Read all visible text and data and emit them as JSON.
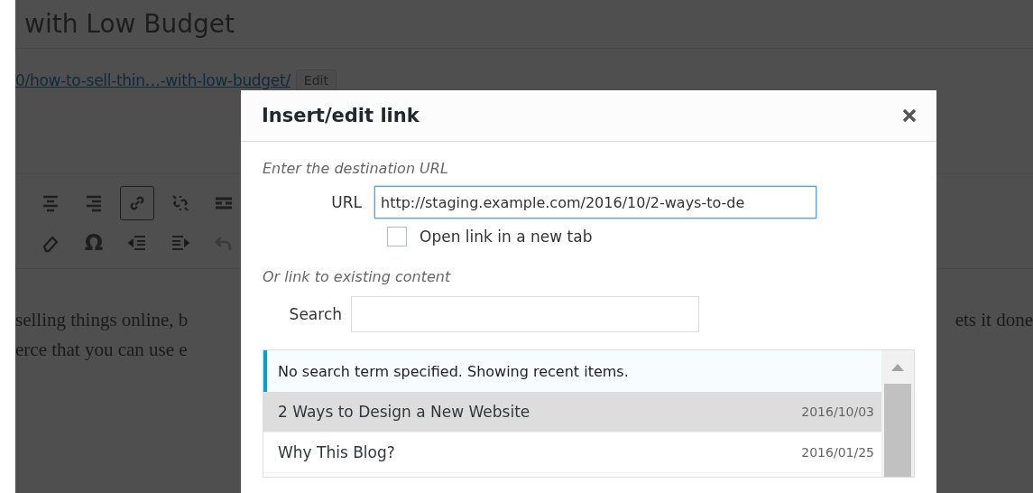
{
  "editor": {
    "title": "with Low Budget",
    "permalink": "0/how-to-sell-thin…-with-low-budget/",
    "edit_button": "Edit",
    "toolbar_rows": [
      [
        {
          "pressed": false
        },
        {
          "pressed": false
        },
        {
          "pressed": true
        },
        {
          "pressed": false
        },
        {
          "pressed": false
        }
      ],
      [
        {
          "pressed": false
        },
        {
          "pressed": false,
          "text": "Ω"
        },
        {
          "pressed": false
        },
        {
          "pressed": false
        },
        {
          "pressed": false
        }
      ]
    ],
    "content_left": [
      "selling things online, b",
      "erce that you can use e"
    ],
    "content_right": [
      "ets it done"
    ]
  },
  "dialog": {
    "title": "Insert/edit link",
    "destination_heading": "Enter the destination URL",
    "url_label": "URL",
    "url_value": "http://staging.example.com/2016/10/2-ways-to-de",
    "new_tab": {
      "label": "Open link in a new tab",
      "checked": false
    },
    "existing_heading": "Or link to existing content",
    "search_label": "Search",
    "notice": "No search term specified. Showing recent items.",
    "results": [
      {
        "title": "2 Ways to Design a New Website",
        "date": "2016/10/03",
        "selected": true
      },
      {
        "title": "Why This Blog?",
        "date": "2016/01/25",
        "selected": false
      }
    ]
  }
}
